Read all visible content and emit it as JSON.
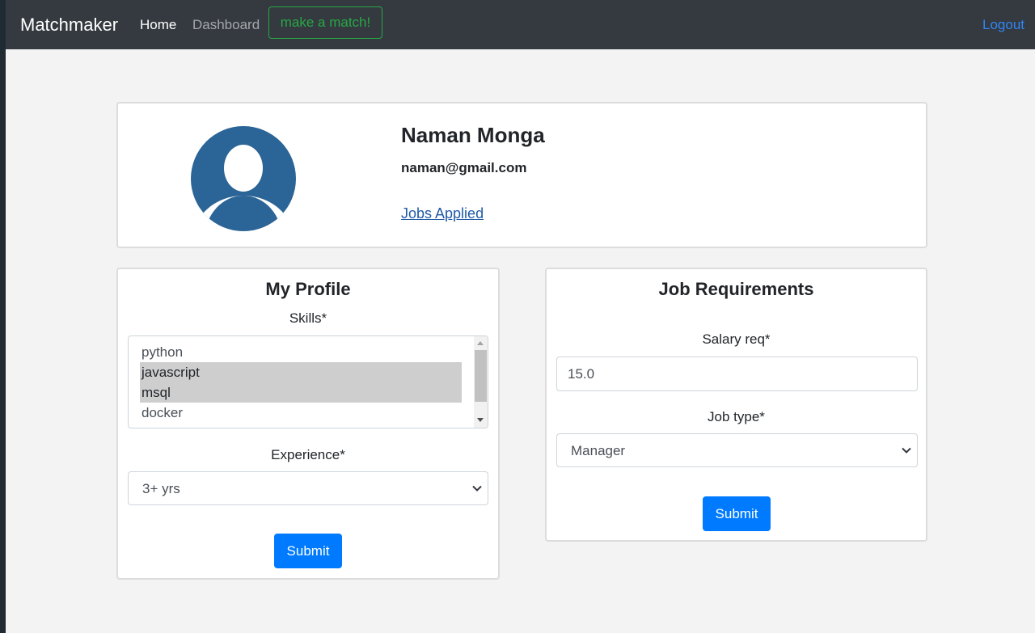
{
  "nav": {
    "brand": "Matchmaker",
    "home": "Home",
    "dashboard": "Dashboard",
    "match_button": "make a match!",
    "logout": "Logout"
  },
  "profile": {
    "name": "Naman Monga",
    "email": "naman@gmail.com",
    "jobs_link": "Jobs Applied",
    "avatar_icon": "user-avatar-icon"
  },
  "my_profile": {
    "title": "My Profile",
    "skills_label": "Skills*",
    "skills": [
      {
        "label": "python",
        "selected": false
      },
      {
        "label": "javascript",
        "selected": true
      },
      {
        "label": "msql",
        "selected": true
      },
      {
        "label": "docker",
        "selected": false
      }
    ],
    "experience_label": "Experience*",
    "experience_value": "3+ yrs",
    "submit": "Submit"
  },
  "job_requirements": {
    "title": "Job Requirements",
    "salary_label": "Salary req*",
    "salary_value": "15.0",
    "job_type_label": "Job type*",
    "job_type_value": "Manager",
    "submit": "Submit"
  },
  "colors": {
    "navbar": "#343a40",
    "match_button": "#28a745",
    "primary": "#007bff",
    "avatar": "#2b6496",
    "link": "#1f5aa6"
  }
}
